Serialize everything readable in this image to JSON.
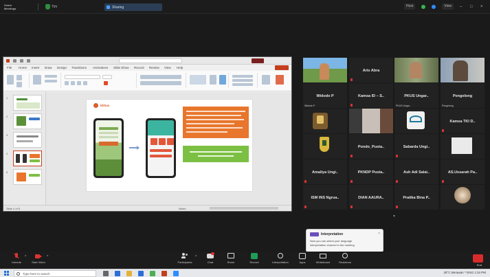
{
  "topbar": {
    "brand": "Zoom\nMeetings",
    "shield_label": "Tim",
    "share_label": "Sharing",
    "right_pills": [
      "Host",
      "View"
    ]
  },
  "powerpoint": {
    "title": "",
    "tabs": [
      "File",
      "Home",
      "Insert",
      "Draw",
      "Design",
      "Transitions",
      "Animations",
      "Slide Show",
      "Record",
      "Review",
      "View",
      "Help"
    ],
    "slide_count": 5,
    "status_left": "Slide 4 of 5",
    "status_right": "Notes",
    "slide": {
      "logo_text": "Elihas",
      "orange_box_text": "",
      "green_box_text": ""
    }
  },
  "gallery": {
    "tiles": [
      {
        "name": "",
        "sub": "",
        "scene": "outdoor"
      },
      {
        "name": "Aris Abra",
        "sub": "",
        "scene": "dark"
      },
      {
        "name": "",
        "sub": "",
        "scene": "room"
      },
      {
        "name": "",
        "sub": "",
        "scene": "room2"
      },
      {
        "name": "Widodo P",
        "sub": "Widodo P",
        "scene": "dark"
      },
      {
        "name": "Kamsa ID – S..",
        "sub": "",
        "scene": "dark"
      },
      {
        "name": "PKUS Ungar..",
        "sub": "PKUS Ungar..",
        "scene": "dark"
      },
      {
        "name": "Pengelong",
        "sub": "Pengelong",
        "scene": "dark"
      },
      {
        "name": "",
        "sub": "",
        "scene": "person"
      },
      {
        "name": "",
        "sub": "",
        "scene": "room3"
      },
      {
        "name": "",
        "sub": "",
        "scene": "logo"
      },
      {
        "name": "Kamsa TKI D..",
        "sub": "",
        "scene": "dark"
      },
      {
        "name": "",
        "sub": "",
        "scene": "emblem"
      },
      {
        "name": "Pondo_Pusta..",
        "sub": "",
        "scene": "dark"
      },
      {
        "name": "Sabarda Ungi..",
        "sub": "",
        "scene": "dark"
      },
      {
        "name": "",
        "sub": "",
        "scene": "blank"
      },
      {
        "name": "Amaliya Ungi..",
        "sub": "",
        "scene": "dark"
      },
      {
        "name": "PKNDP Pusta..",
        "sub": "",
        "scene": "dark"
      },
      {
        "name": "Ash Adi Salai..",
        "sub": "",
        "scene": "dark"
      },
      {
        "name": "AS.Ussarah Pa..",
        "sub": "",
        "scene": "dark"
      },
      {
        "name": "ISM INS Ngrua..",
        "sub": "",
        "scene": "dark"
      },
      {
        "name": "DIAN AAURA..",
        "sub": "",
        "scene": "dark"
      },
      {
        "name": "Pratika Bina P..",
        "sub": "",
        "scene": "dark"
      },
      {
        "name": "",
        "sub": "",
        "scene": "avatar"
      }
    ]
  },
  "toast": {
    "title": "Interpretation",
    "line1": "Now you can select your language",
    "line2": "interpretation channel in the meeting"
  },
  "controls": {
    "left": [
      {
        "label": "Unmute",
        "icon": "mic-muted-icon",
        "color": "#d33"
      },
      {
        "label": "Start Video",
        "icon": "video-off-icon",
        "color": "#d33"
      }
    ],
    "center": [
      {
        "label": "Participants",
        "icon": "participants-icon"
      },
      {
        "label": "Chat",
        "icon": "chat-icon"
      },
      {
        "label": "Share",
        "icon": "share-screen-icon"
      },
      {
        "label": "Record",
        "icon": "record-icon"
      },
      {
        "label": "Interpretation",
        "icon": "globe-icon"
      },
      {
        "label": "Apps",
        "icon": "apps-icon"
      },
      {
        "label": "Whiteboard",
        "icon": "whiteboard-icon"
      },
      {
        "label": "Reactions",
        "icon": "reactions-icon"
      }
    ],
    "end_label": "End"
  },
  "taskbar": {
    "search_placeholder": "Type here to search",
    "tray_text": "28°C Berawan  ^  ENG  1:34 PM"
  }
}
